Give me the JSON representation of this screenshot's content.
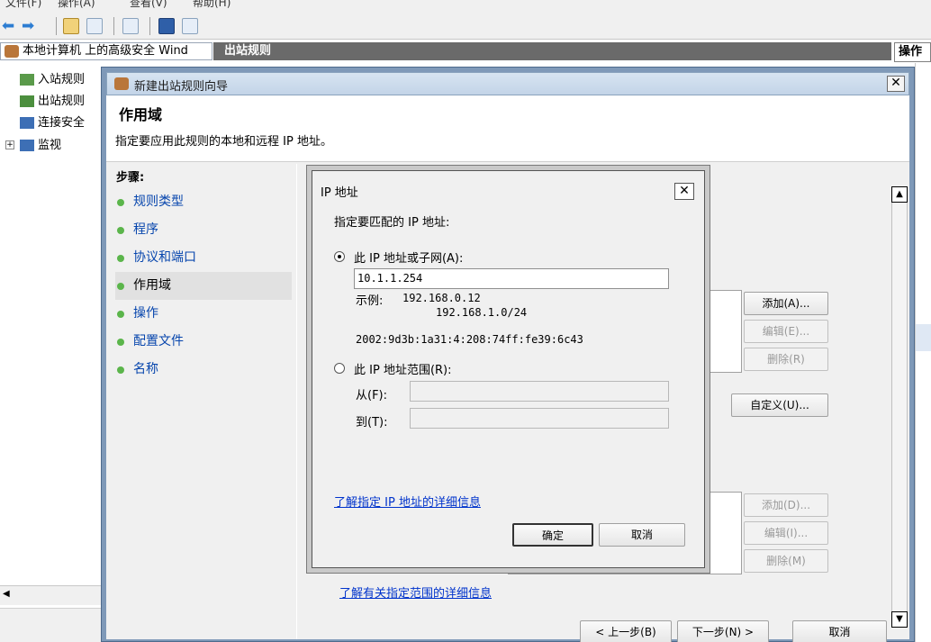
{
  "mmc": {
    "tree_title": "本地计算机 上的高级安全 Wind",
    "rules_tab": "出站规则",
    "action_header": "操作",
    "tree_items": [
      "入站规则",
      "出站规则",
      "连接安全",
      "监视"
    ],
    "colors": {
      "tab_bg": "#6a6a6a",
      "title_gradient": "#c3d4e8"
    }
  },
  "wizard": {
    "title": "新建出站规则向导",
    "heading": "作用域",
    "description": "指定要应用此规则的本地和远程 IP 地址。",
    "steps_label": "步骤:",
    "steps": [
      "规则类型",
      "程序",
      "协议和端口",
      "作用域",
      "操作",
      "配置文件",
      "名称"
    ],
    "active_step": "作用域",
    "local_buttons": {
      "add": "添加(A)...",
      "edit": "编辑(E)...",
      "remove": "删除(R)"
    },
    "customize": "自定义(U)...",
    "remote_buttons": {
      "add": "添加(D)...",
      "edit": "编辑(I)...",
      "remove": "删除(M)"
    },
    "scope_link": "了解有关指定范围的详细信息",
    "footer": {
      "back": "< 上一步(B)",
      "next": "下一步(N) >",
      "cancel": "取消"
    }
  },
  "ip_dialog": {
    "title": "IP 地址",
    "prompt": "指定要匹配的 IP 地址:",
    "option_subnet": "此 IP 地址或子网(A):",
    "subnet_value": "10.1.1.254",
    "example_label": "示例:",
    "example_1": "192.168.0.12",
    "example_2": "192.168.1.0/24",
    "example_3": "2002:9d3b:1a31:4:208:74ff:fe39:6c43",
    "option_range": "此 IP 地址范围(R):",
    "from_label": "从(F):",
    "to_label": "到(T):",
    "from_value": "",
    "to_value": "",
    "learn_link": "了解指定 IP 地址的详细信息",
    "ok": "确定",
    "cancel": "取消",
    "selected_option": "subnet"
  }
}
